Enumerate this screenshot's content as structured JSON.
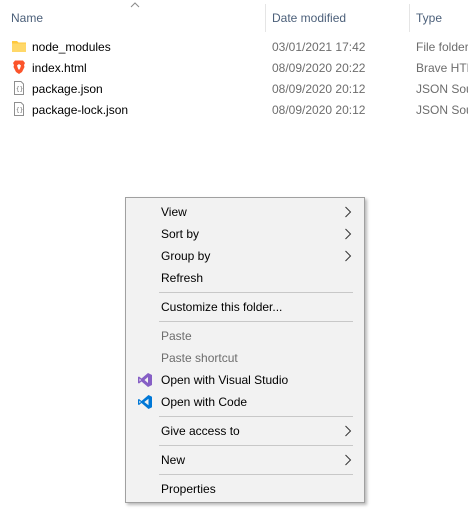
{
  "columns": {
    "name": "Name",
    "date_modified": "Date modified",
    "type": "Type"
  },
  "files": [
    {
      "name": "node_modules",
      "date": "03/01/2021 17:42",
      "type": "File folder",
      "icon": "folder-icon"
    },
    {
      "name": "index.html",
      "date": "08/09/2020 20:22",
      "type": "Brave HTML Document",
      "icon": "brave-icon"
    },
    {
      "name": "package.json",
      "date": "08/09/2020 20:12",
      "type": "JSON Source File",
      "icon": "json-file-icon"
    },
    {
      "name": "package-lock.json",
      "date": "08/09/2020 20:12",
      "type": "JSON Source File",
      "icon": "json-file-icon"
    }
  ],
  "context_menu": {
    "view": "View",
    "sort_by": "Sort by",
    "group_by": "Group by",
    "refresh": "Refresh",
    "customize": "Customize this folder...",
    "paste": "Paste",
    "paste_shortcut": "Paste shortcut",
    "open_visual_studio": "Open with Visual Studio",
    "open_code": "Open with Code",
    "give_access": "Give access to",
    "new": "New",
    "properties": "Properties"
  },
  "colors": {
    "folder": "#ffc83d",
    "brave": "#fb542b",
    "visual_studio": "#865fc5",
    "vscode": "#0078d7",
    "header_text": "#4c607a",
    "menu_bg": "#f2f2f2"
  }
}
